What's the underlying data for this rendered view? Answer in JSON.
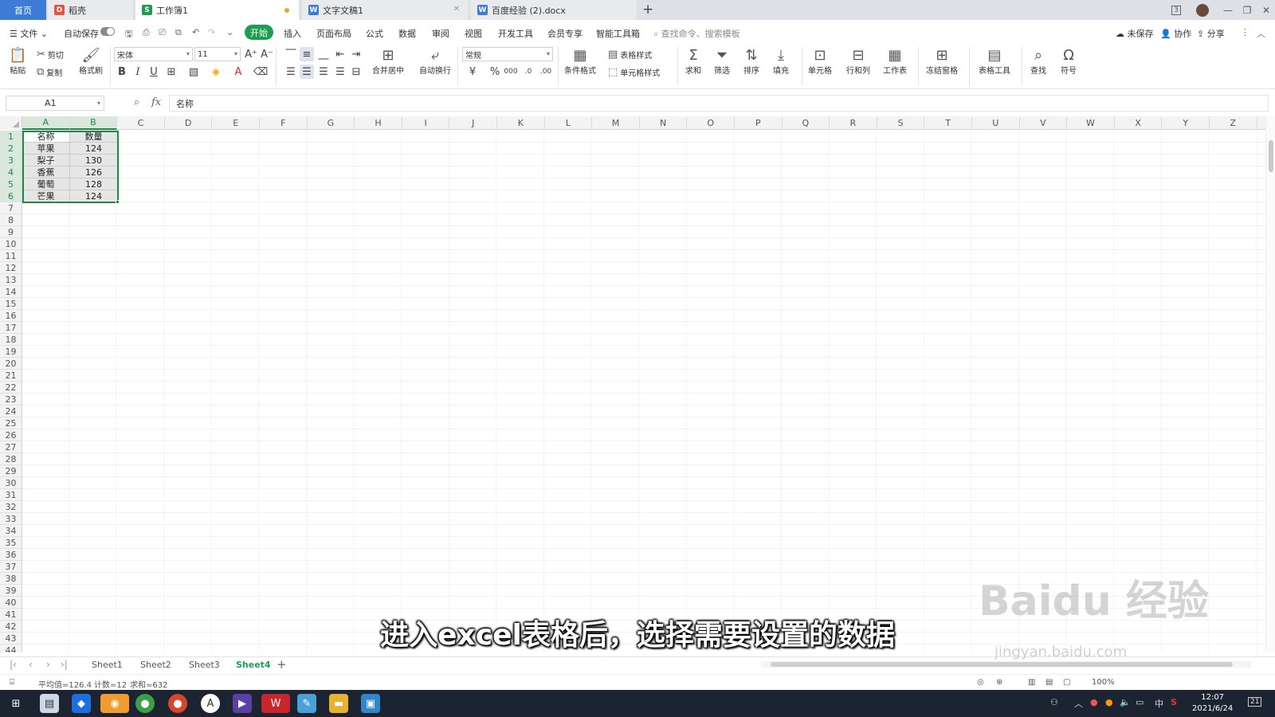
{
  "tabs": {
    "home": "首页",
    "daoke": "稻壳",
    "workbook": "工作簿1",
    "doc1": "文字文稿1",
    "doc2": "百度经验 (2).docx",
    "add": "+"
  },
  "window": {
    "badge": "3"
  },
  "menubar": {
    "file": "文件",
    "autosave": "自动保存",
    "start": "开始",
    "items": [
      "插入",
      "页面布局",
      "公式",
      "数据",
      "审阅",
      "视图",
      "开发工具",
      "会员专享",
      "智能工具箱"
    ],
    "search_placeholder": "查找命令、搜索模板",
    "unsaved": "未保存",
    "collab": "协作",
    "share": "分享"
  },
  "ribbon": {
    "paste": "粘贴",
    "cut": "剪切",
    "copy": "复制",
    "format_painter": "格式刷",
    "font_name": "宋体",
    "font_size": "11",
    "merge_center": "合并居中",
    "auto_wrap": "自动换行",
    "number_format": "常规",
    "table_style": "表格样式",
    "cond_format": "条件格式",
    "cell_style": "单元格样式",
    "sum": "求和",
    "filter": "筛选",
    "sort": "排序",
    "fill": "填充",
    "cell": "单元格",
    "row_col": "行和列",
    "worksheet": "工作表",
    "freeze": "冻结窗格",
    "table_tools": "表格工具",
    "find": "查找",
    "symbol": "符号"
  },
  "formula": {
    "name_box": "A1",
    "fx": "fx",
    "content": "名称"
  },
  "columns": [
    "A",
    "B",
    "C",
    "D",
    "E",
    "F",
    "G",
    "H",
    "I",
    "J",
    "K",
    "L",
    "M",
    "N",
    "O",
    "P",
    "Q",
    "R",
    "S",
    "T",
    "U",
    "V",
    "W",
    "X",
    "Y",
    "Z"
  ],
  "rows": [
    "1",
    "2",
    "3",
    "4",
    "5",
    "6",
    "7",
    "8",
    "9",
    "10",
    "11",
    "12",
    "13",
    "14",
    "15",
    "16",
    "17",
    "18",
    "19",
    "20",
    "21",
    "22",
    "23",
    "24",
    "25",
    "26",
    "27",
    "28",
    "29",
    "30",
    "31",
    "32",
    "33",
    "34",
    "35",
    "36",
    "37",
    "38",
    "39",
    "40",
    "41",
    "42",
    "43",
    "44"
  ],
  "data": [
    [
      "名称",
      "数量"
    ],
    [
      "苹果",
      "124"
    ],
    [
      "梨子",
      "130"
    ],
    [
      "香蕉",
      "126"
    ],
    [
      "葡萄",
      "128"
    ],
    [
      "芒果",
      "124"
    ]
  ],
  "sheets": [
    "Sheet1",
    "Sheet2",
    "Sheet3",
    "Sheet4"
  ],
  "active_sheet": "Sheet4",
  "status": {
    "average": "平均值=126.4",
    "count": "计数=12",
    "sum": "求和=632",
    "zoom": "100%"
  },
  "taskbar": {
    "time": "12:07",
    "date": "2021/6/24",
    "ime": "中",
    "notify": "21"
  },
  "subtitle": "进入excel表格后，选择需要设置的数据",
  "watermark": {
    "brand": "Baidu 经验",
    "url": "jingyan.baidu.com"
  },
  "colors": {
    "accent_green": "#1d9e4e",
    "tab_blue": "#3c7bd6",
    "selection": "#1d8a45"
  }
}
